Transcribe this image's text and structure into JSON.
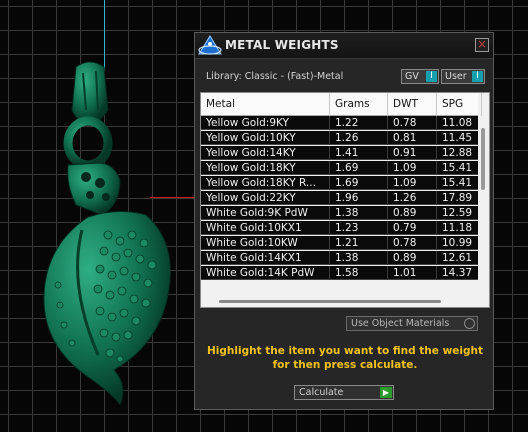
{
  "dialog": {
    "title": "METAL WEIGHTS",
    "close_glyph": "×",
    "library_label": "Library: Classic - (Fast)-Metal",
    "gv_label": "GV",
    "user_label": "User",
    "toggle_glyph": "I"
  },
  "table": {
    "columns": [
      "Metal",
      "Grams",
      "DWT",
      "SPG"
    ],
    "rows": [
      [
        "Yellow Gold:9KY",
        "1.22",
        "0.78",
        "11.08"
      ],
      [
        "Yellow Gold:10KY",
        "1.26",
        "0.81",
        "11.45"
      ],
      [
        "Yellow Gold:14KY",
        "1.41",
        "0.91",
        "12.88"
      ],
      [
        "Yellow Gold:18KY",
        "1.69",
        "1.09",
        "15.41"
      ],
      [
        "Yellow Gold:18KY R...",
        "1.69",
        "1.09",
        "15.41"
      ],
      [
        "Yellow Gold:22KY",
        "1.96",
        "1.26",
        "17.89"
      ],
      [
        "White Gold:9K PdW",
        "1.38",
        "0.89",
        "12.59"
      ],
      [
        "White Gold:10KX1",
        "1.23",
        "0.79",
        "11.18"
      ],
      [
        "White Gold:10KW",
        "1.21",
        "0.78",
        "10.99"
      ],
      [
        "White Gold:14KX1",
        "1.38",
        "0.89",
        "12.61"
      ],
      [
        "White Gold:14K PdW",
        "1.58",
        "1.01",
        "14.37"
      ]
    ]
  },
  "use_object_materials_label": "Use Object Materials",
  "instructions": "Highlight the item you want to find the weight for then press calculate.",
  "calculate_label": "Calculate",
  "calculate_glyph": "▶",
  "colors": {
    "accent_teal": "#16a0ad",
    "instruction_yellow": "#f3c21a",
    "model_green": "#0f6a4a"
  },
  "icons": [
    "app-logo-icon",
    "close-icon",
    "play-icon"
  ]
}
